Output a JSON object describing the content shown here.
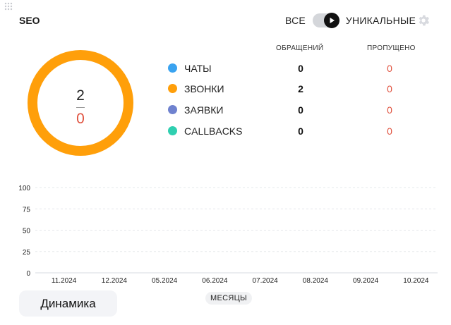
{
  "widget": {
    "title": "SEO"
  },
  "toggle": {
    "all_label": "ВСЕ",
    "unique_label": "УНИКАЛЬНЫЕ",
    "state": "unique"
  },
  "table": {
    "headers": {
      "requests": "ОБРАЩЕНИЙ",
      "missed": "ПРОПУЩЕНО"
    },
    "rows": [
      {
        "label": "ЧАТЫ",
        "color": "#3aa3f0",
        "requests": "0",
        "missed": "0"
      },
      {
        "label": "ЗВОНКИ",
        "color": "#ff9f0a",
        "requests": "2",
        "missed": "0"
      },
      {
        "label": "ЗАЯВКИ",
        "color": "#6f82cf",
        "requests": "0",
        "missed": "0"
      },
      {
        "label": "CALLBACKS",
        "color": "#2fcfb0",
        "requests": "0",
        "missed": "0"
      }
    ]
  },
  "donut": {
    "total": "2",
    "missed": "0",
    "color": "#ff9f0a",
    "missed_color": "#e0523f"
  },
  "chart_data": {
    "type": "bar",
    "categories": [
      "11.2024",
      "12.2024",
      "05.2024",
      "06.2024",
      "07.2024",
      "08.2024",
      "09.2024",
      "10.2024"
    ],
    "values": [
      0,
      0,
      0,
      0,
      0,
      0,
      0,
      0
    ],
    "y_ticks": [
      "100",
      "75",
      "50",
      "25",
      "0"
    ],
    "ylim": [
      0,
      100
    ],
    "xlabel": "МЕСЯЦЫ",
    "grid": true
  },
  "actions": {
    "dynamics_label": "Динамика"
  },
  "icons": {
    "drag": "drag-handle-icon",
    "settings": "gear-icon",
    "toggle_knob": "play-icon"
  }
}
